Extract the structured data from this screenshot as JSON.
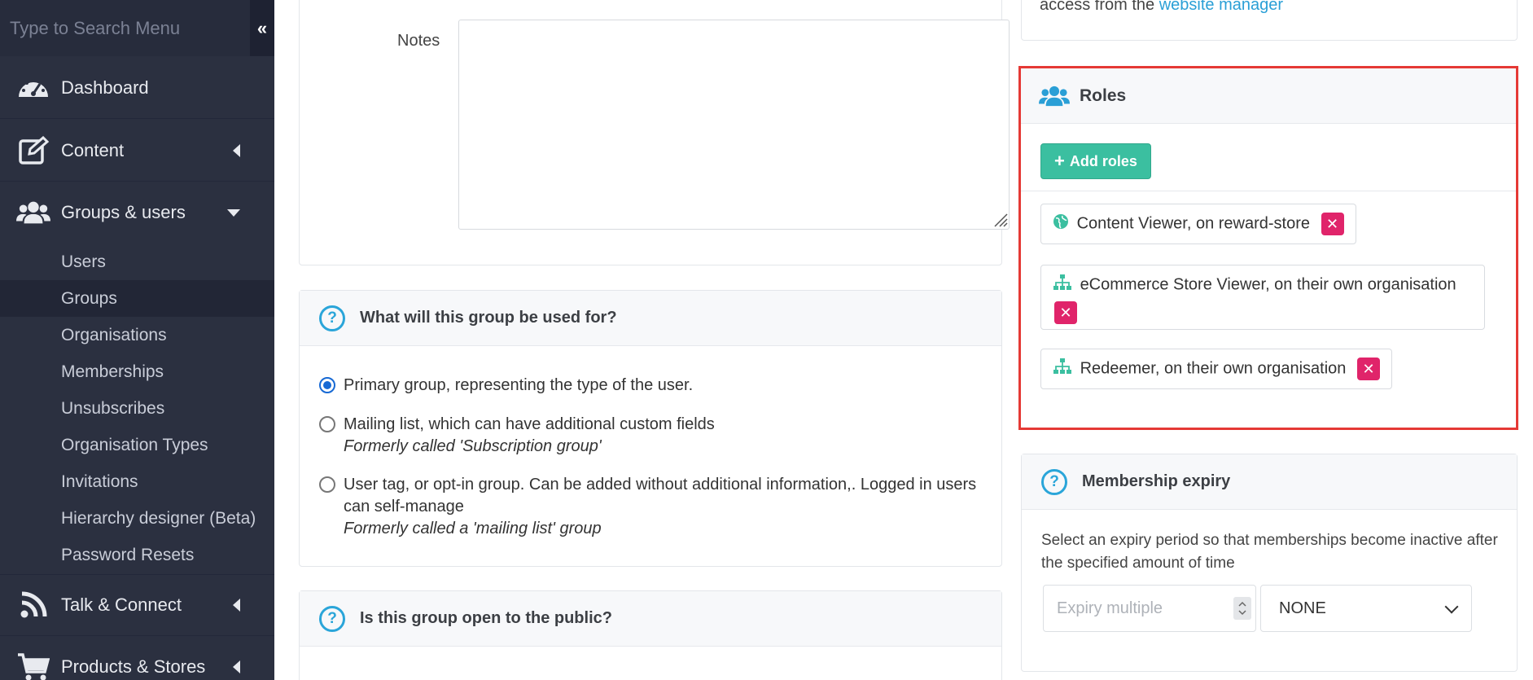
{
  "sidebar": {
    "search_placeholder": "Type to Search Menu",
    "collapse_glyph": "«",
    "items": [
      {
        "label": "Dashboard",
        "icon": "dashboard-icon"
      },
      {
        "label": "Content",
        "icon": "edit-icon"
      },
      {
        "label": "Groups & users",
        "icon": "users-icon"
      },
      {
        "label": "Talk & Connect",
        "icon": "rss-icon"
      },
      {
        "label": "Products & Stores",
        "icon": "cart-icon"
      }
    ],
    "sub_items": [
      "Users",
      "Groups",
      "Organisations",
      "Memberships",
      "Unsubscribes",
      "Organisation Types",
      "Invitations",
      "Hierarchy designer (Beta)",
      "Password Resets"
    ],
    "active_sub_item": "Groups"
  },
  "top_panel": {
    "notes_label": "Notes"
  },
  "usage_panel": {
    "title": "What will this group be used for?",
    "options": [
      {
        "text": "Primary group, representing the type of the user.",
        "sub": "",
        "checked": true
      },
      {
        "text": "Mailing list, which can have additional custom fields",
        "sub": "Formerly called 'Subscription group'",
        "checked": false
      },
      {
        "text": "User tag, or opt-in group. Can be added without additional information,. Logged in users can self-manage",
        "sub": "Formerly called a 'mailing list' group",
        "checked": false
      }
    ]
  },
  "public_panel": {
    "title": "Is this group open to the public?"
  },
  "website_panel": {
    "text_prefix": "access from the ",
    "link": "website manager"
  },
  "roles": {
    "title": "Roles",
    "add_label": "Add roles",
    "items": [
      {
        "label": "Content Viewer, on reward-store",
        "icon": "globe-icon"
      },
      {
        "label": "eCommerce Store Viewer, on their own organisation",
        "icon": "org-chart-icon"
      },
      {
        "label": "Redeemer, on their own organisation",
        "icon": "org-chart-icon"
      }
    ],
    "accent_color": "#3bbfa0",
    "delete_color": "#e0246a"
  },
  "expiry": {
    "title": "Membership expiry",
    "description": "Select an expiry period so that memberships become inactive after the specified amount of time",
    "multiple_placeholder": "Expiry multiple",
    "period_value": "NONE"
  }
}
